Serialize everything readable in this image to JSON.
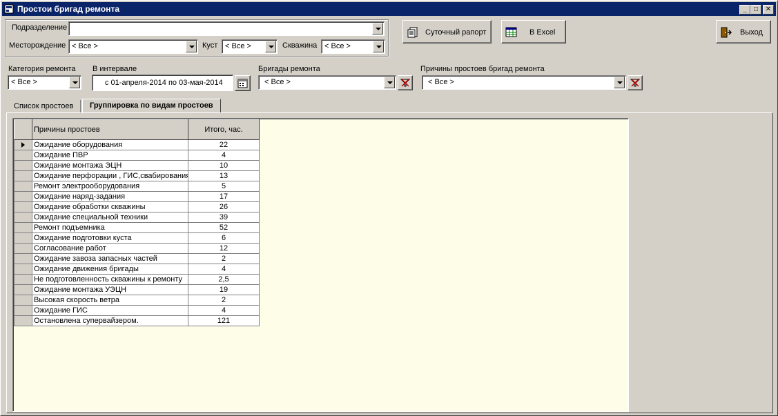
{
  "window": {
    "title": "Простои бригад ремонта"
  },
  "filters": {
    "division_label": "Подразделение",
    "division_value": "",
    "field_label": "Месторождение",
    "field_value": "< Все >",
    "cluster_label": "Куст",
    "cluster_value": "< Все >",
    "well_label": "Скважина",
    "well_value": "< Все >",
    "category_label": "Категория ремонта",
    "category_value": "< Все >",
    "interval_label": "В интервале",
    "interval_value": "с 01-апреля-2014 по 03-мая-2014",
    "brigades_label": "Бригады ремонта",
    "brigades_value": "< Все >",
    "reasons_label": "Причины простоев бригад ремонта",
    "reasons_value": "< Все >"
  },
  "toolbar": {
    "daily_report_label": "Суточный рапорт",
    "excel_label": "В Excel",
    "exit_label": "Выход"
  },
  "tabs": [
    {
      "label": "Список простоев",
      "active": false
    },
    {
      "label": "Группировка по видам простоев",
      "active": true
    }
  ],
  "grid": {
    "columns": [
      "Причины простоев",
      "Итого, час."
    ],
    "rows": [
      {
        "reason": "Ожидание оборудования",
        "total": "22"
      },
      {
        "reason": "Ожидание ПВР",
        "total": "4"
      },
      {
        "reason": "Ожидание монтажа ЭЦН",
        "total": "10"
      },
      {
        "reason": "Ожидание перфорации , ГИС,свабирования",
        "total": "13"
      },
      {
        "reason": "Ремонт электрооборудования",
        "total": "5"
      },
      {
        "reason": "Ожидание наряд-задания",
        "total": "17"
      },
      {
        "reason": "Ожидание обработки скважины",
        "total": "26"
      },
      {
        "reason": "Ожидание специальной техники",
        "total": "39"
      },
      {
        "reason": "Ремонт подъемника",
        "total": "52"
      },
      {
        "reason": "Ожидание подготовки  куста",
        "total": "6"
      },
      {
        "reason": "Согласование работ",
        "total": "12"
      },
      {
        "reason": "Ожидание завоза запасных частей",
        "total": "2"
      },
      {
        "reason": "Ожидание движения бригады",
        "total": "4"
      },
      {
        "reason": "Не подготовленность скважины к ремонту",
        "total": "2,5"
      },
      {
        "reason": "Ожидание монтажа УЭЦН",
        "total": "19"
      },
      {
        "reason": "Высокая скорость ветра",
        "total": "2"
      },
      {
        "reason": "Ожидание ГИС",
        "total": "4"
      },
      {
        "reason": "Остановлена супервайзером.",
        "total": "121"
      }
    ]
  },
  "colors": {
    "titlebar": "#0a246a",
    "face": "#d4d0c8",
    "grid_background": "#fdfde8"
  }
}
